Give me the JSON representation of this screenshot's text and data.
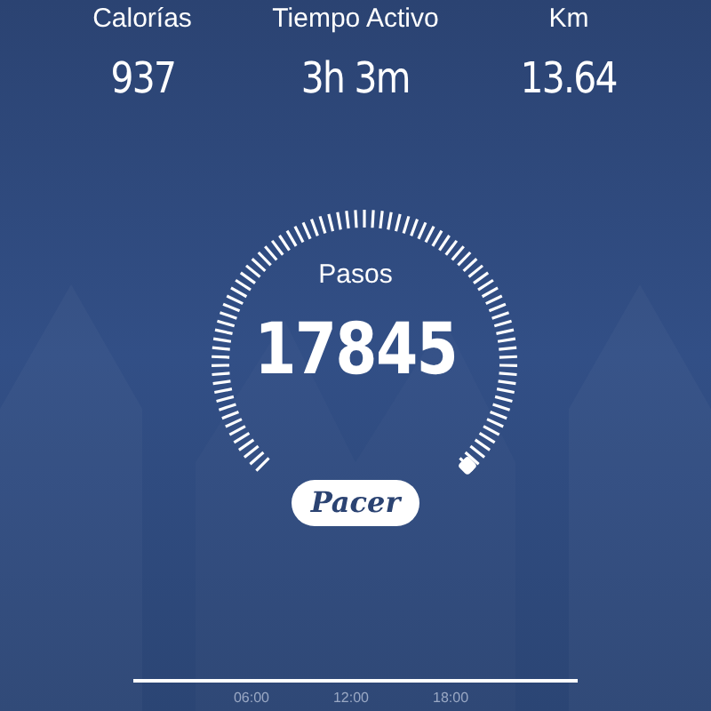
{
  "stats": [
    {
      "label": "Calorías",
      "value": "937"
    },
    {
      "label": "Tiempo Activo",
      "value": "3h 3m"
    },
    {
      "label": "Km",
      "value": "13.64"
    }
  ],
  "gauge": {
    "label": "Pasos",
    "value": "17845"
  },
  "badge": {
    "label": "Pacer"
  },
  "timeline": {
    "ticks": [
      "06:00",
      "12:00",
      "18:00"
    ]
  }
}
